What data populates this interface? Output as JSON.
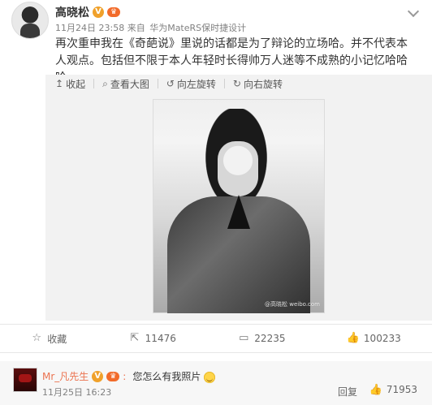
{
  "post": {
    "username": "高晓松",
    "meta": {
      "time": "11月24日 23:58",
      "source_prefix": "来自",
      "device": "华为MateRS保时捷设计"
    },
    "content": "再次重申我在《奇葩说》里说的话都是为了辩论的立场哈。并不代表本人观点。包括但不限于本人年轻时长得帅万人迷等不成熟的小记忆哈哈哈。"
  },
  "media_toolbar": {
    "collapse": "收起",
    "view_large": "查看大图",
    "rotate_left": "向左旋转",
    "rotate_right": "向右旋转"
  },
  "photo": {
    "watermark": "@高晓松 weibo.com"
  },
  "actions": {
    "favorite": "收藏",
    "repost_count": "11476",
    "comment_count": "22235",
    "like_count": "100233"
  },
  "comment": {
    "username": "Mr_凡先生",
    "text": "您怎么有我照片",
    "time": "11月25日 16:23",
    "reply": "回复",
    "likes": "71953"
  },
  "icons": {
    "verify": "verified-badge-icon",
    "vip": "vip-badge-icon",
    "collapse": "collapse-icon",
    "view_large": "search-icon",
    "rotate_left": "rotate-left-icon",
    "rotate_right": "rotate-right-icon",
    "favorite": "star-icon",
    "repost": "repost-icon",
    "comment": "comment-icon",
    "like": "thumbs-up-icon",
    "emoji": "emoji-icon",
    "dropdown": "chevron-down-icon"
  },
  "colors": {
    "link_orange": "#eb7350",
    "text_main": "#333333",
    "text_meta": "#808080",
    "panel_bg": "#f2f2f2",
    "border": "#e6e6e6"
  }
}
